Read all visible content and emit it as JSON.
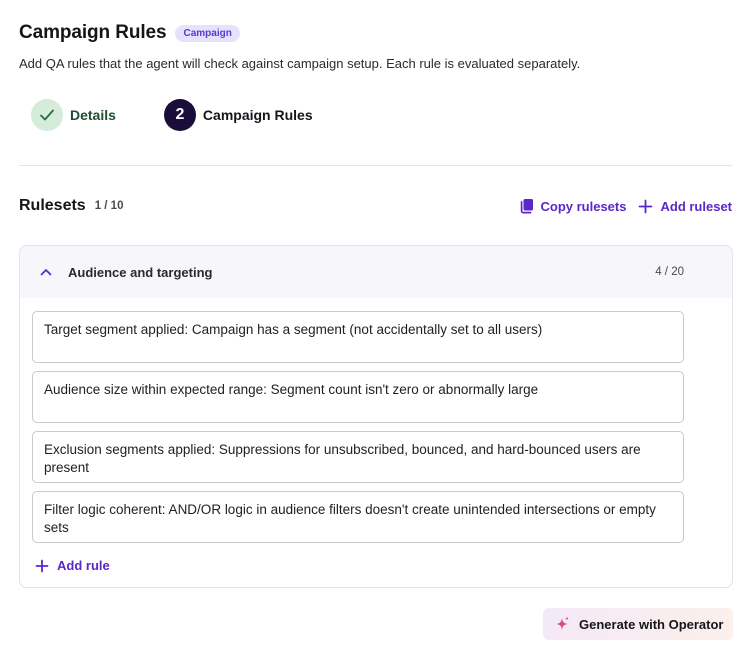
{
  "header": {
    "title": "Campaign Rules",
    "badge": "Campaign",
    "subtitle": "Add QA rules that the agent will check against campaign setup. Each rule is evaluated separately."
  },
  "stepper": {
    "steps": [
      {
        "label": "Details",
        "state": "complete",
        "icon": "check-icon"
      },
      {
        "label": "Campaign Rules",
        "state": "active",
        "number": "2"
      }
    ]
  },
  "rulesets": {
    "title": "Rulesets",
    "count": "1 / 10",
    "copy_label": "Copy rulesets",
    "add_label": "Add ruleset"
  },
  "ruleset": {
    "name": "Audience and targeting",
    "count": "4 / 20",
    "rules": [
      "Target segment applied: Campaign has a segment (not accidentally set to all users)",
      "Audience size within expected range: Segment count isn't zero or abnormally large",
      "Exclusion segments applied: Suppressions for unsubscribed, bounced, and hard-bounced users are present",
      "Filter logic coherent: AND/OR logic in audience filters doesn't create unintended intersections or empty sets"
    ],
    "add_rule_label": "Add rule"
  },
  "generate": {
    "label": "Generate with Operator",
    "icon": "sparkle-icon"
  },
  "colors": {
    "accent": "#5a27c9",
    "step_complete_bg": "#d4ecd9",
    "step_active_bg": "#1a0d3a",
    "badge_bg": "#e6e2fb"
  }
}
